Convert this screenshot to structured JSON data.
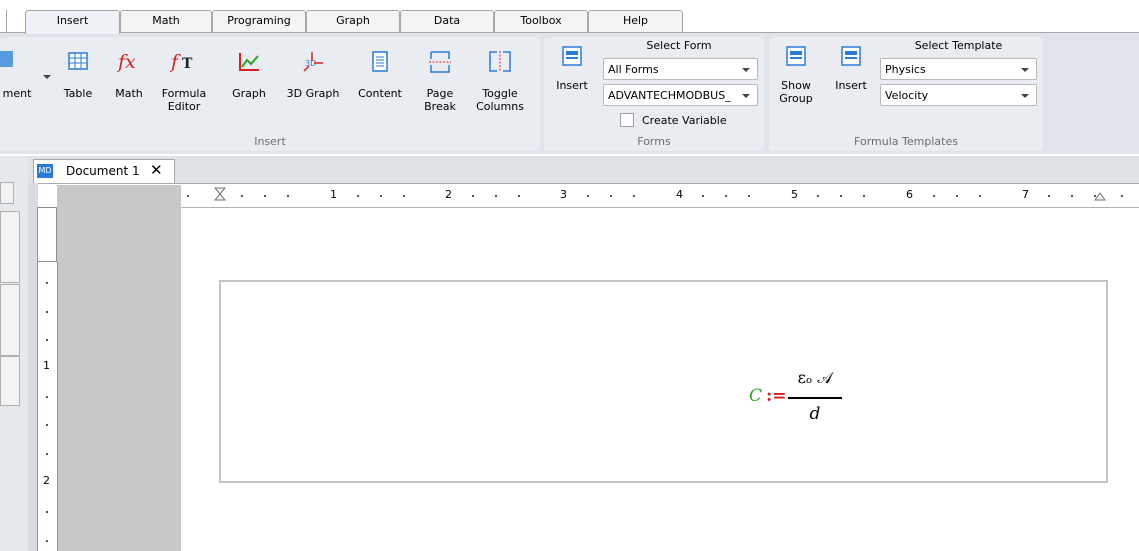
{
  "ribbon_tabs": [
    {
      "label": "Insert",
      "active": true
    },
    {
      "label": "Math"
    },
    {
      "label": "Programing"
    },
    {
      "label": "Graph"
    },
    {
      "label": "Data"
    },
    {
      "label": "Toolbox"
    },
    {
      "label": "Help"
    }
  ],
  "insert_group": {
    "label": "Insert",
    "comment_partial": "ment",
    "table": "Table",
    "math": "Math",
    "formula_editor_1": "Formula",
    "formula_editor_2": "Editor",
    "graph": "Graph",
    "graph3d": "3D Graph",
    "content": "Content",
    "page_break_1": "Page",
    "page_break_2": "Break",
    "toggle_columns_1": "Toggle",
    "toggle_columns_2": "Columns"
  },
  "forms_group": {
    "label": "Forms",
    "insert": "Insert",
    "select_form": "Select Form",
    "combo1": "All Forms",
    "combo2": "ADVANTECHMODBUS_",
    "create_variable": "Create Variable"
  },
  "templates_group": {
    "label": "Formula Templates",
    "show_group_1": "Show",
    "show_group_2": "Group",
    "insert": "Insert",
    "select_template": "Select Template",
    "combo1": "Physics",
    "combo2": "Velocity"
  },
  "document": {
    "tab_badge": "MD",
    "tab_title": "Document 1",
    "close_glyph": "✕"
  },
  "ruler": {
    "h_numbers": [
      "1",
      "2",
      "3",
      "4",
      "5",
      "6",
      "7"
    ],
    "v_numbers": [
      "1",
      "2"
    ]
  },
  "formula": {
    "lhs": "C",
    "assign": ":=",
    "numerator": "εₒ 𝒜",
    "denominator": "d"
  },
  "colors": {
    "lhs_green": "#2aa52a",
    "assign_red": "#d42020",
    "icon_blue": "#2b7bd6",
    "icon_red": "#d42020",
    "icon_green": "#2aa52a"
  }
}
